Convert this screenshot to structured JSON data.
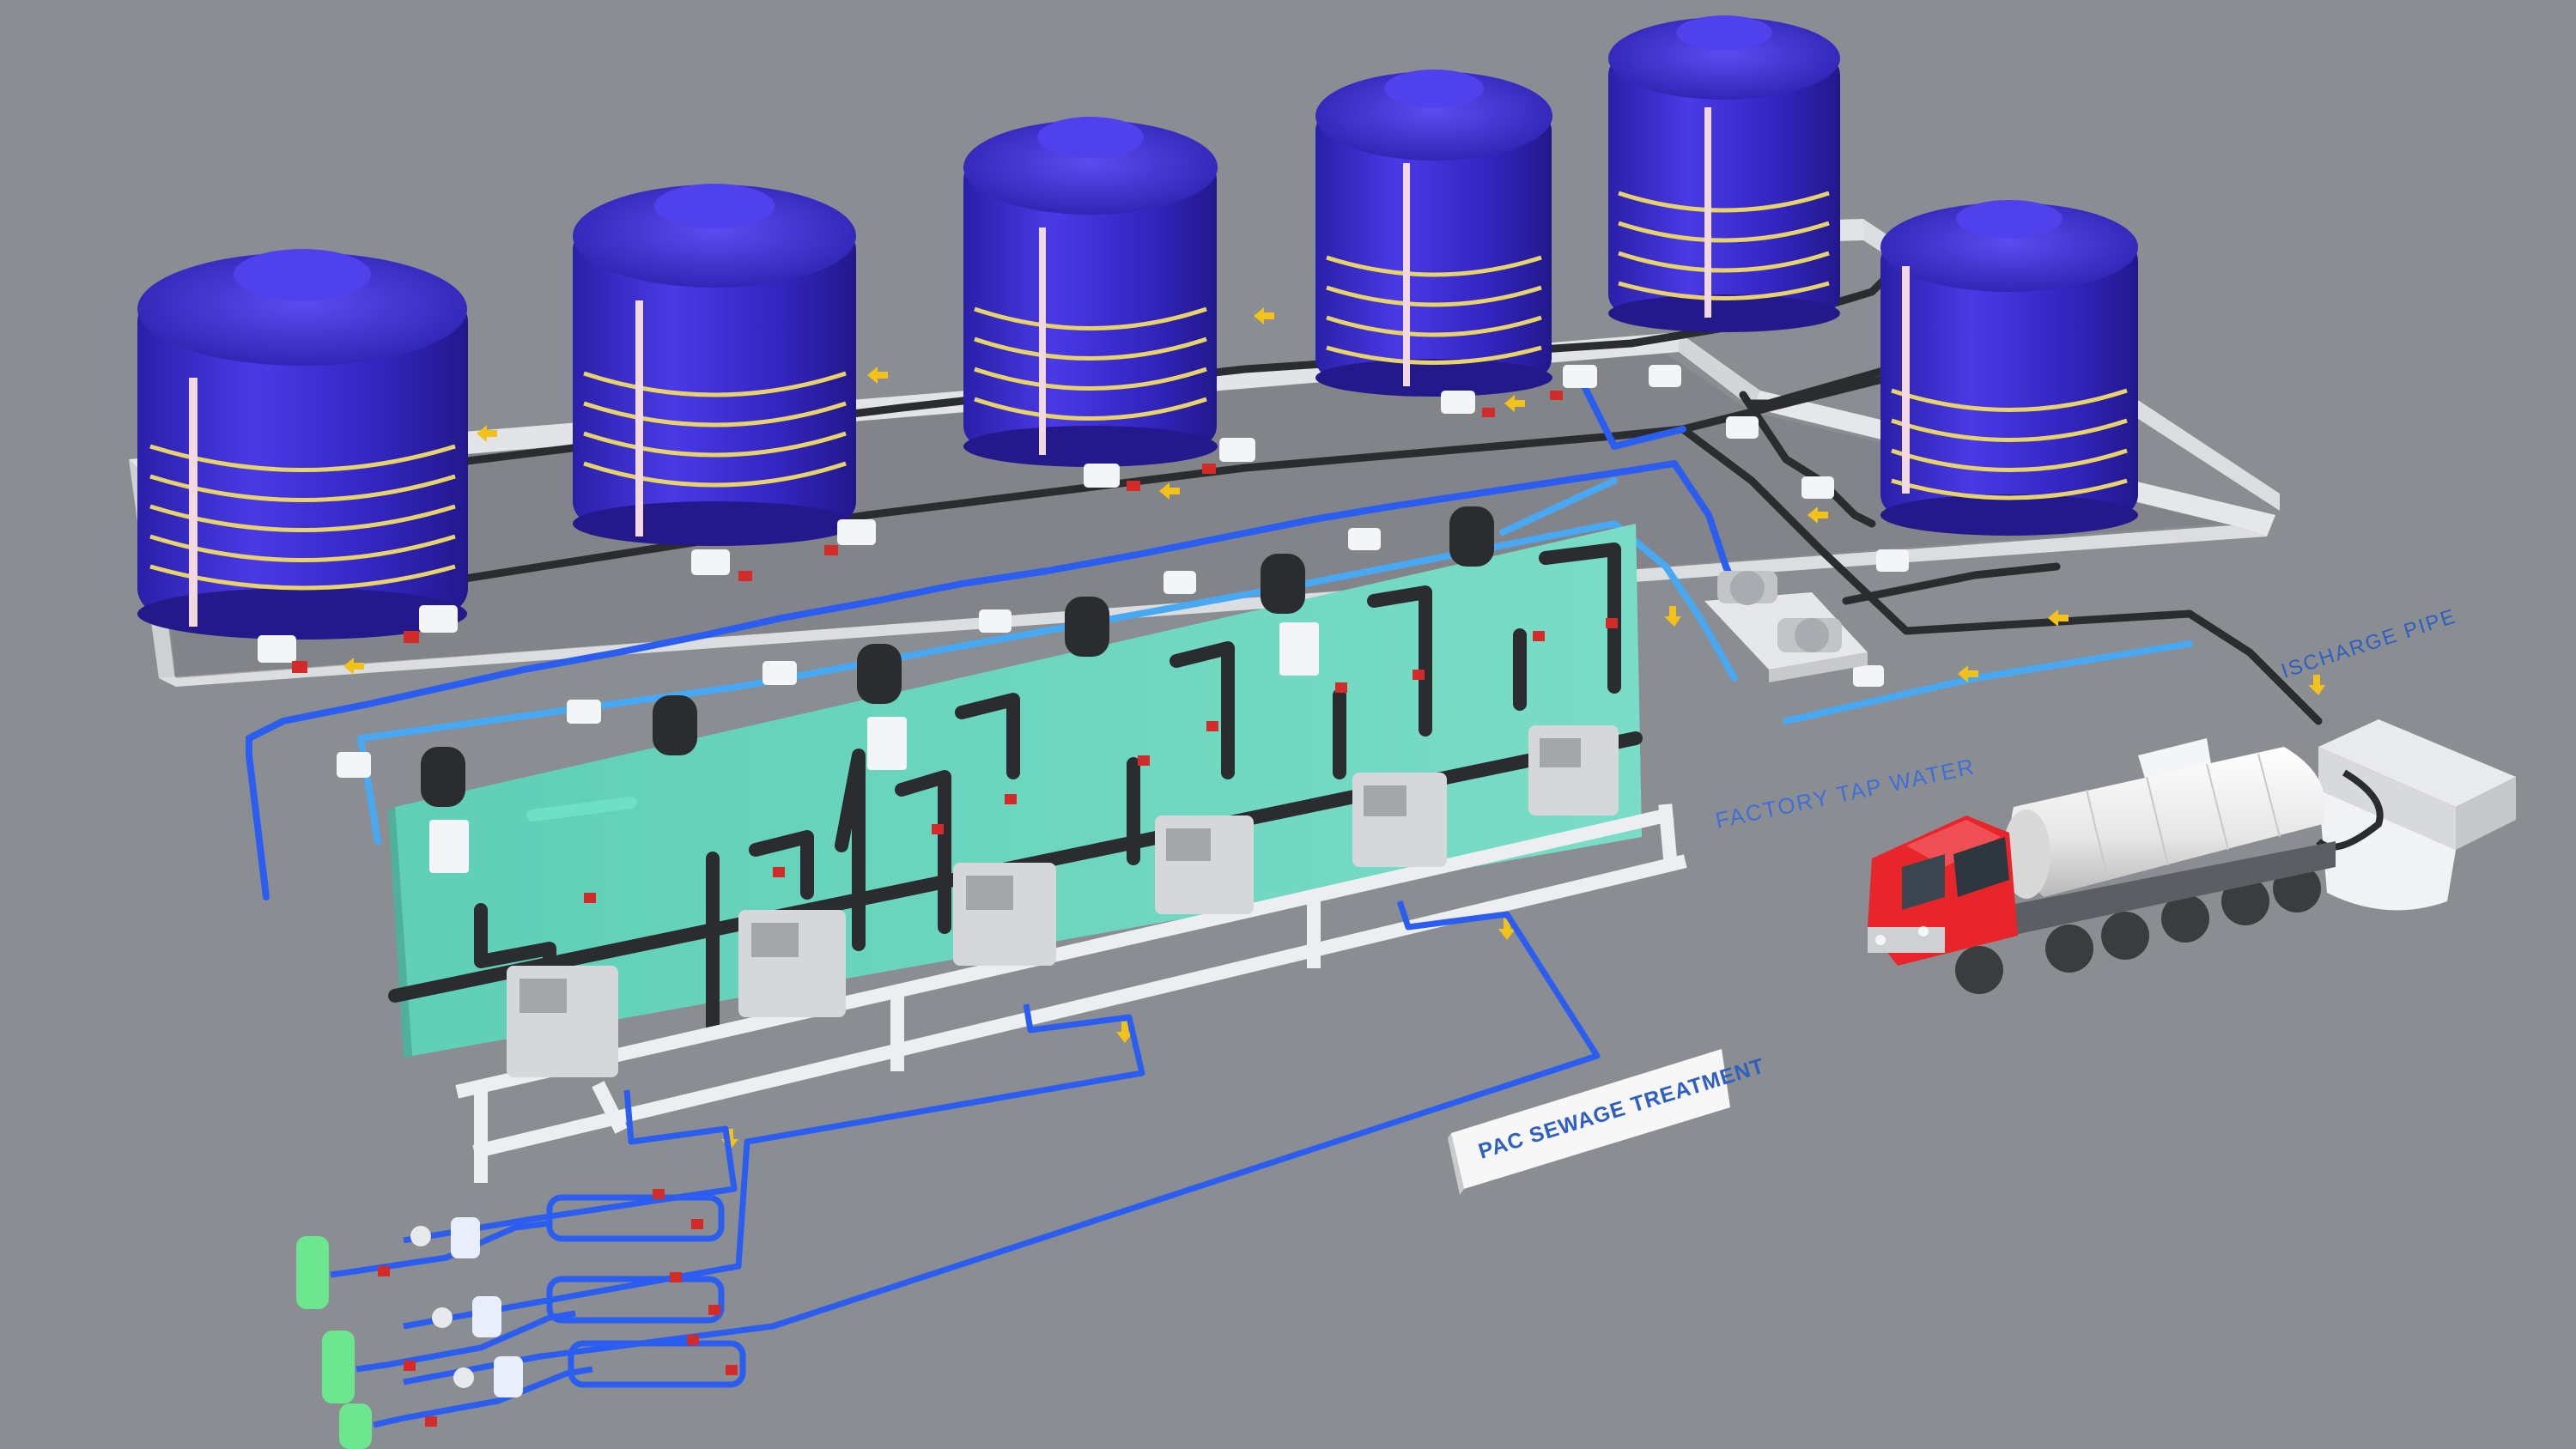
{
  "labels": {
    "factory_tap_water": "FACTORY TAP WATER",
    "discharge_pipe": "ISCHARGE PIPE",
    "pac_sign": "PAC SEWAGE TREATMENT"
  },
  "components": {
    "storage_tank_count": 6,
    "dosing_unit_count": 6,
    "flowmeter_assembly_count": 3
  },
  "colors": {
    "background": "#8a8d92",
    "tank": "#3e2fd0",
    "tank_band": "#e8d36a",
    "panel": "#6fd6bf",
    "pipe_blue": "#2b5ef0",
    "pipe_light_blue": "#49a8f2",
    "pipe_black": "#2a2c30",
    "truck_cab": "#e8252b",
    "truck_tank": "#f4f4f4",
    "arrow": "#f2c21b",
    "frame": "#e8e9ec"
  },
  "icons": [
    "storage-tank-icon",
    "valve-icon",
    "pump-icon",
    "truck-icon",
    "flow-arrow-icon",
    "dosing-unit-icon",
    "control-box-icon"
  ]
}
